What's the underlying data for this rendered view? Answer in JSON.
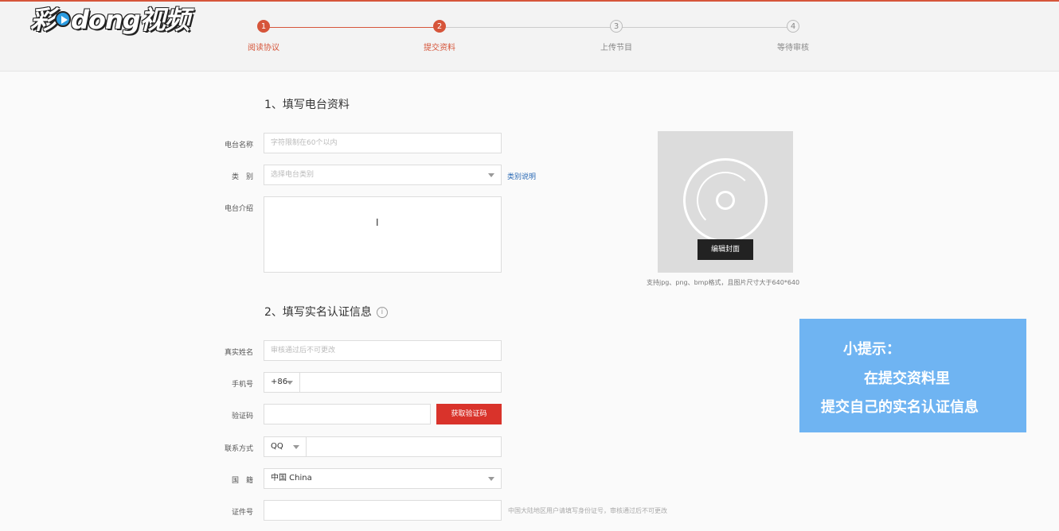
{
  "brand": {
    "logo_text_1": "彩",
    "logo_text_2": "dong视频"
  },
  "steps": [
    {
      "num": "1",
      "label": "阅读协议"
    },
    {
      "num": "2",
      "label": "提交资料"
    },
    {
      "num": "3",
      "label": "上传节目"
    },
    {
      "num": "4",
      "label": "等待审核"
    }
  ],
  "section1": {
    "title": "1、填写电台资料",
    "name_label": "电台名称",
    "name_placeholder": "字符限制在60个以内",
    "category_label": "类　别",
    "category_placeholder": "选择电台类别",
    "category_link": "类别说明",
    "intro_label": "电台介绍",
    "intro_value": ""
  },
  "cover": {
    "button": "编辑封面",
    "note": "支持jpg、png、bmp格式，且图片尺寸大于640*640"
  },
  "section2": {
    "title": "2、填写实名认证信息",
    "info_icon": "i",
    "realname_label": "真实姓名",
    "realname_placeholder": "审核通过后不可更改",
    "phone_label": "手机号",
    "phone_prefix": "+86",
    "code_label": "验证码",
    "code_button": "获取验证码",
    "contact_label": "联系方式",
    "contact_type": "QQ",
    "nationality_label": "国　籍",
    "nationality_value": "中国 China",
    "id_label": "证件号",
    "id_note": "中国大陆地区用户请填写身份证号，审核通过后不可更改"
  },
  "tip": {
    "line1": "小提示：",
    "line2": "在提交资料里",
    "line3": "提交自己的实名认证信息"
  }
}
